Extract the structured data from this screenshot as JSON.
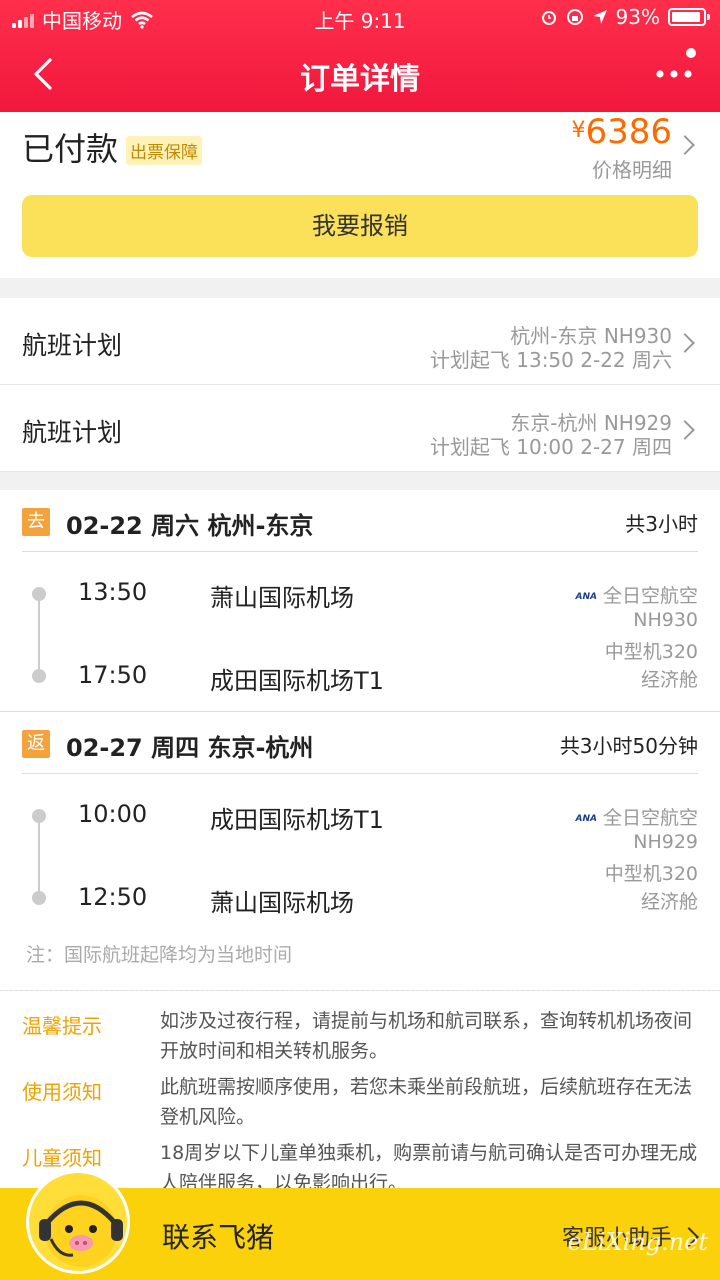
{
  "status_bar": {
    "carrier": "中国移动",
    "time": "上午 9:11",
    "battery": "93%",
    "battery_level": 0.93
  },
  "header": {
    "title": "订单详情",
    "back_icon": "chevron-left-icon",
    "more_icon": "more-icon"
  },
  "order": {
    "status": "已付款",
    "badge": "出票保障",
    "currency": "¥",
    "price": "6386",
    "price_detail": "价格明细",
    "reimburse_button": "我要报销"
  },
  "plans": [
    {
      "label": "航班计划",
      "route": "杭州-东京 NH930",
      "schedule": "计划起飞 13:50 2-22 周六"
    },
    {
      "label": "航班计划",
      "route": "东京-杭州 NH929",
      "schedule": "计划起飞 10:00 2-27 周四"
    }
  ],
  "segments": [
    {
      "tag": "去",
      "title": "02-22 周六 杭州-东京",
      "duration": "共3小时",
      "dep_time": "13:50",
      "dep_airport": "萧山国际机场",
      "arr_time": "17:50",
      "arr_airport": "成田国际机场T1",
      "airline_logo": "ANA",
      "airline": "全日空航空",
      "flight_no": "NH930",
      "aircraft": "中型机320",
      "cabin": "经济舱"
    },
    {
      "tag": "返",
      "title": "02-27 周四 东京-杭州",
      "duration": "共3小时50分钟",
      "dep_time": "10:00",
      "dep_airport": "成田国际机场T1",
      "arr_time": "12:50",
      "arr_airport": "萧山国际机场",
      "airline_logo": "ANA",
      "airline": "全日空航空",
      "flight_no": "NH929",
      "aircraft": "中型机320",
      "cabin": "经济舱"
    }
  ],
  "note": "注：国际航班起降均为当地时间",
  "tips": [
    {
      "key": "温馨提示",
      "value": "如涉及过夜行程，请提前与机场和航司联系，查询转机机场夜间开放时间和相关转机服务。"
    },
    {
      "key": "使用须知",
      "value": "此航班需按顺序使用，若您未乘坐前段航班，后续航班存在无法登机风险。"
    },
    {
      "key": "儿童须知",
      "value": "18周岁以下儿童单独乘机，购票前请与航司确认是否可办理无成人陪伴服务，以免影响出行。"
    }
  ],
  "footer": {
    "contact": "联系飞猪",
    "service": "客服小助手",
    "watermark": "eLiXing.net"
  },
  "colors": {
    "header_red": "#f1173d",
    "price_orange": "#ff6a00",
    "button_yellow": "#fbe05a",
    "tag_orange": "#f4a23b",
    "tip_orange": "#f0a300",
    "footer_yellow": "#fbd10b"
  }
}
